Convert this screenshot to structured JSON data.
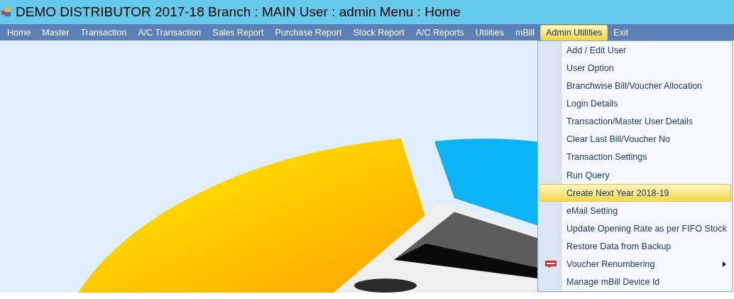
{
  "window": {
    "title": "DEMO DISTRIBUTOR 2017-18 Branch : MAIN User : admin Menu : Home"
  },
  "menu_bar": [
    {
      "label": "Home",
      "selected": false
    },
    {
      "label": "Master",
      "selected": false
    },
    {
      "label": "Transaction",
      "selected": false
    },
    {
      "label": "A/C Transaction",
      "selected": false
    },
    {
      "label": "Sales Report",
      "selected": false
    },
    {
      "label": "Purchase Report",
      "selected": false
    },
    {
      "label": "Stock Report",
      "selected": false
    },
    {
      "label": "A/C Reports",
      "selected": false
    },
    {
      "label": "Utilities",
      "selected": false
    },
    {
      "label": "mBill",
      "selected": false
    },
    {
      "label": "Admin Utilities",
      "selected": true
    },
    {
      "label": "Exit",
      "selected": false
    }
  ],
  "dropdown": {
    "items": [
      {
        "label": "Add / Edit User",
        "selected": false,
        "new_badge": false,
        "submenu": false
      },
      {
        "label": "User Option",
        "selected": false,
        "new_badge": false,
        "submenu": false
      },
      {
        "label": "Branchwise Bill/Voucher Allocation",
        "selected": false,
        "new_badge": false,
        "submenu": false
      },
      {
        "label": "Login Details",
        "selected": false,
        "new_badge": false,
        "submenu": false
      },
      {
        "label": "Transaction/Master User Details",
        "selected": false,
        "new_badge": false,
        "submenu": false
      },
      {
        "label": "Clear Last Bill/Voucher No",
        "selected": false,
        "new_badge": false,
        "submenu": false
      },
      {
        "label": "Transaction Settings",
        "selected": false,
        "new_badge": false,
        "submenu": false
      },
      {
        "label": "Run Query",
        "selected": false,
        "new_badge": false,
        "submenu": false
      },
      {
        "label": "Create Next Year 2018-19",
        "selected": true,
        "new_badge": false,
        "submenu": false
      },
      {
        "label": "eMail Setting",
        "selected": false,
        "new_badge": false,
        "submenu": false
      },
      {
        "label": "Update Opening Rate as per FIFO Stock",
        "selected": false,
        "new_badge": false,
        "submenu": false
      },
      {
        "label": "Restore Data from Backup",
        "selected": false,
        "new_badge": false,
        "submenu": false
      },
      {
        "label": "Voucher Renumbering",
        "selected": false,
        "new_badge": true,
        "submenu": true
      },
      {
        "label": "Manage mBill Device Id",
        "selected": false,
        "new_badge": false,
        "submenu": false
      }
    ]
  }
}
